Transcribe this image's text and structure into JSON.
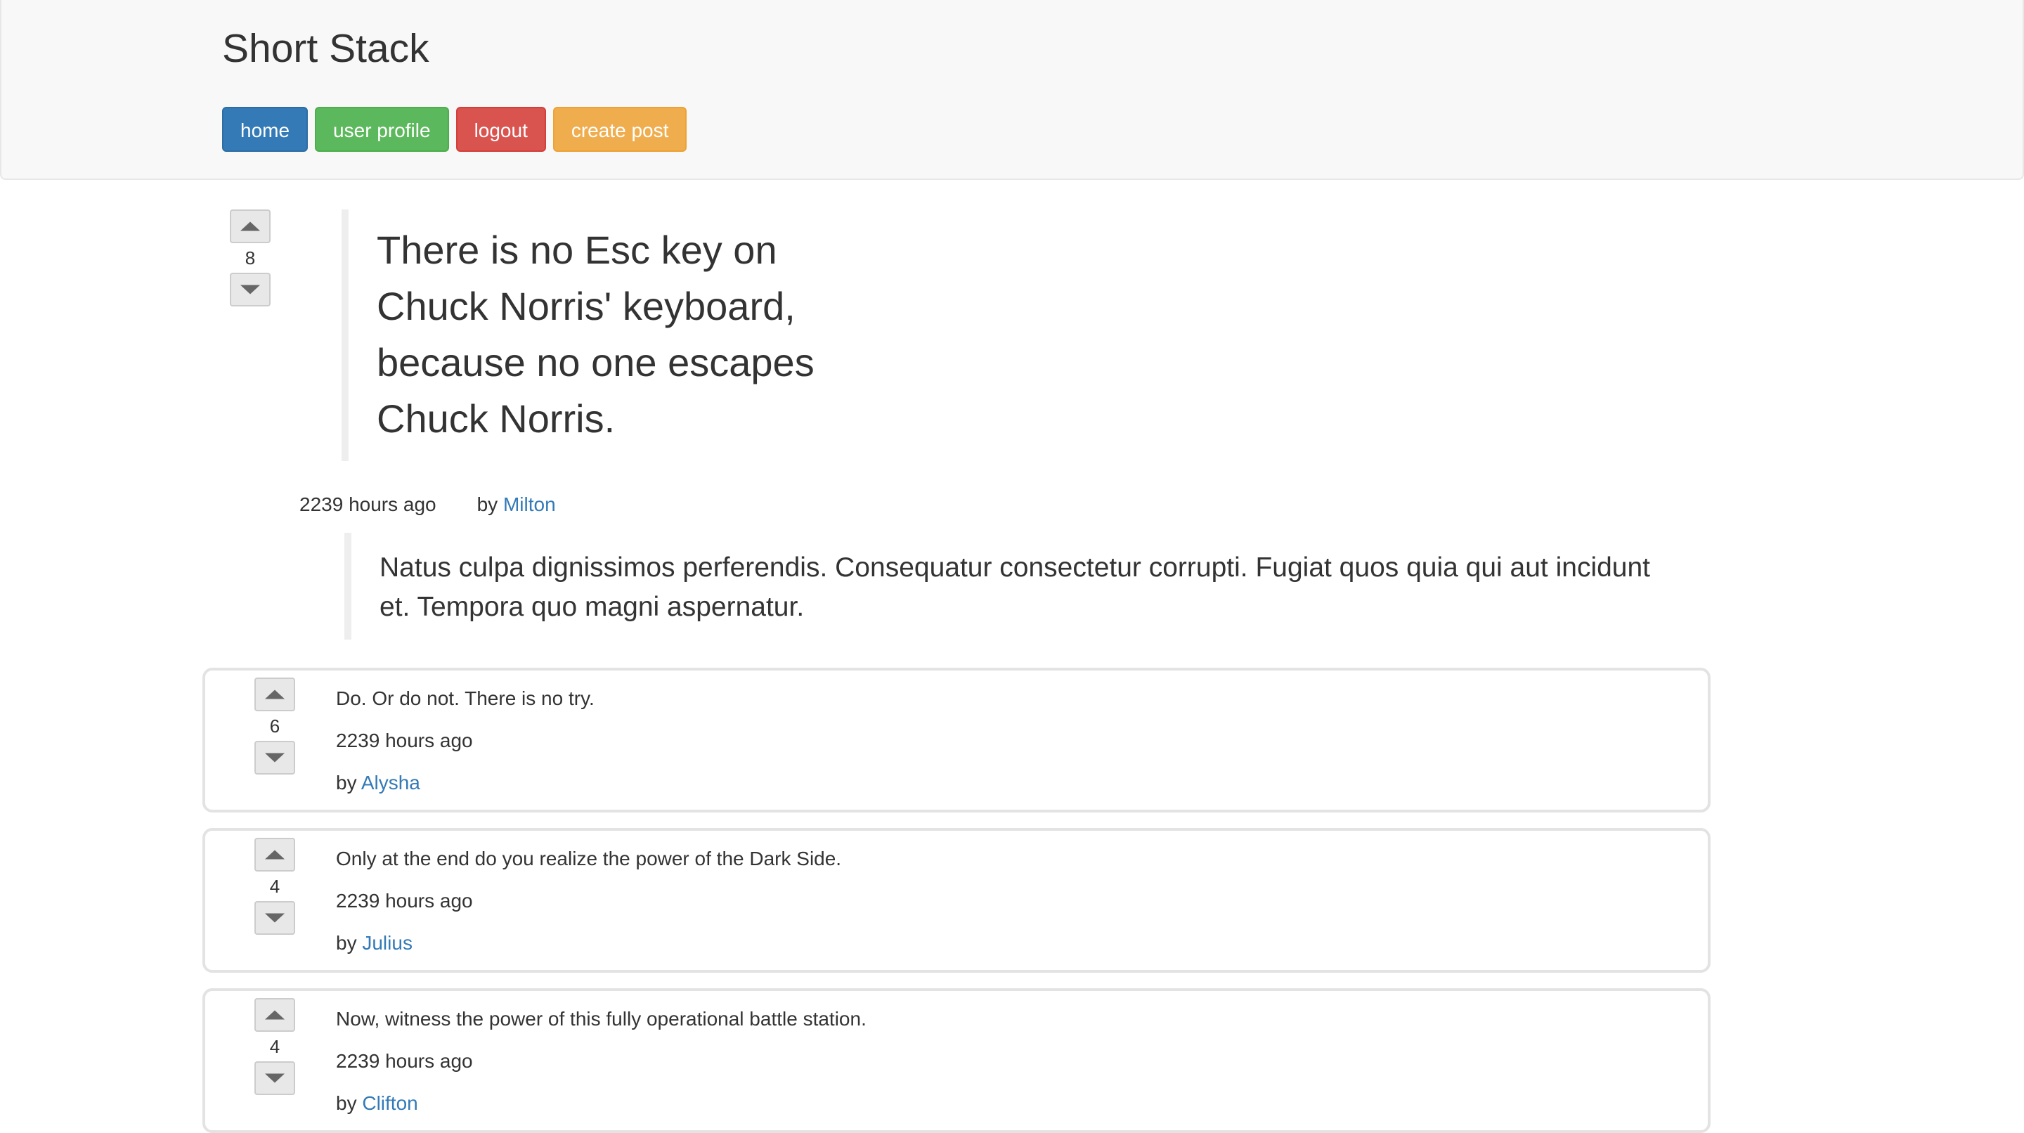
{
  "app": {
    "title": "Short Stack"
  },
  "nav": {
    "home": "home",
    "user_profile": "user profile",
    "logout": "logout",
    "create_post": "create post"
  },
  "post": {
    "votes": "8",
    "text": "There is no Esc key on Chuck Norris' keyboard, because no one escapes Chuck Norris.",
    "time": "2239 hours ago",
    "by_label": "by",
    "author": "Milton",
    "description": "Natus culpa dignissimos perferendis. Consequatur consectetur corrupti. Fugiat quos quia qui aut incidunt et. Tempora quo magni aspernatur."
  },
  "comments": [
    {
      "votes": "6",
      "text": "Do. Or do not. There is no try.",
      "time": "2239 hours ago",
      "by_label": "by",
      "author": "Alysha"
    },
    {
      "votes": "4",
      "text": "Only at the end do you realize the power of the Dark Side.",
      "time": "2239 hours ago",
      "by_label": "by",
      "author": "Julius"
    },
    {
      "votes": "4",
      "text": "Now, witness the power of this fully operational battle station.",
      "time": "2239 hours ago",
      "by_label": "by",
      "author": "Clifton"
    }
  ],
  "colors": {
    "primary": "#337ab7",
    "success": "#5cb85c",
    "danger": "#d9534f",
    "warning": "#f0ad4e",
    "navbar_bg": "#f8f8f8"
  },
  "icons": {
    "upvote": "triangle-up-icon",
    "downvote": "triangle-down-icon"
  }
}
